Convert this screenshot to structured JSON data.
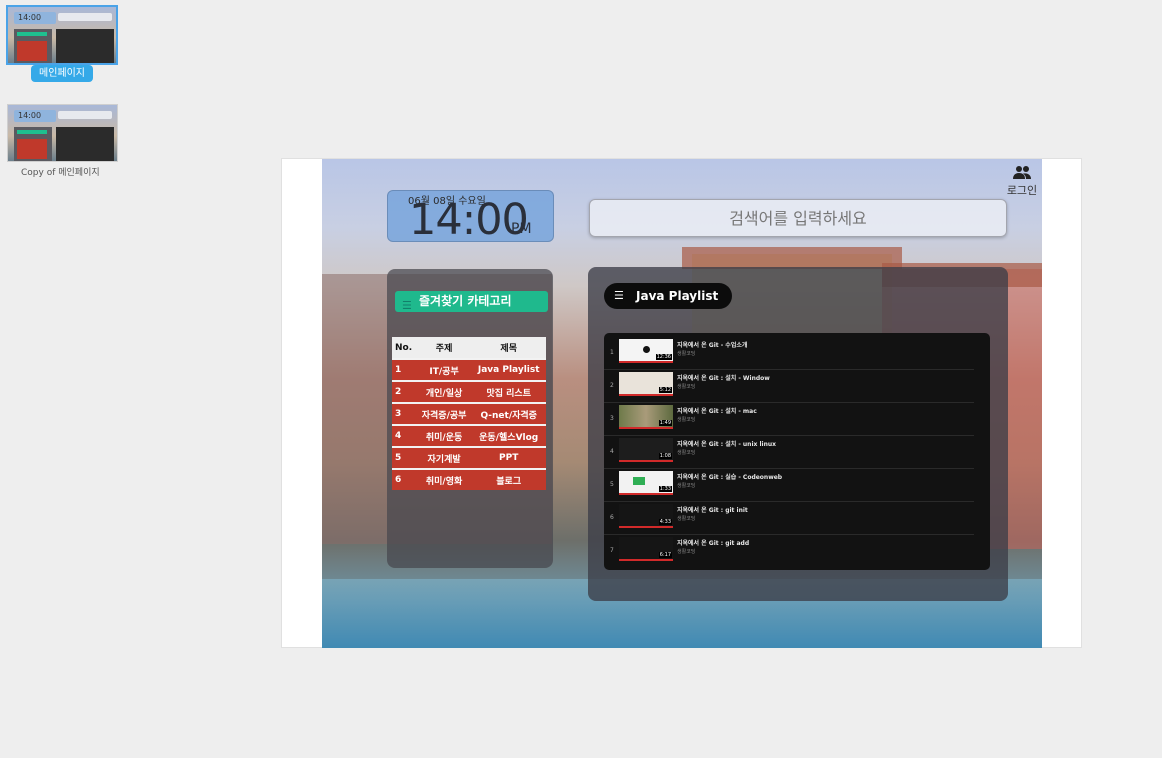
{
  "pages": [
    {
      "label": "메인페이지",
      "selected": true
    },
    {
      "label": "Copy of 메인페이지",
      "selected": false
    }
  ],
  "clock": {
    "date": "06월 08일 수요일",
    "time": "14:00",
    "ampm": "PM"
  },
  "search": {
    "placeholder": "검색어를 입력하세요"
  },
  "login": {
    "label": "로그인",
    "icon": "people-icon"
  },
  "bookmarks": {
    "title": "즐겨찾기 카테고리",
    "icon": "menu-icon",
    "columns": [
      "No.",
      "주제",
      "제목"
    ],
    "rows": [
      [
        "1",
        "IT/공부",
        "Java Playlist"
      ],
      [
        "2",
        "개인/일상",
        "맛집 리스트"
      ],
      [
        "3",
        "자격증/공부",
        "Q-net/자격증"
      ],
      [
        "4",
        "취미/운동",
        "운동/헬스Vlog"
      ],
      [
        "5",
        "자기계발",
        "PPT"
      ],
      [
        "6",
        "취미/영화",
        "블로그"
      ]
    ],
    "row_color": "#c0392b",
    "header_color": "#1fb98d"
  },
  "playlist": {
    "title": "Java Playlist",
    "icon": "menu-icon",
    "items": [
      {
        "num": "1",
        "title": "지옥에서 온 Git - 수업소개",
        "channel": "생활코딩",
        "duration": "12:36"
      },
      {
        "num": "2",
        "title": "지옥에서 온 Git : 설치 - Window",
        "channel": "생활코딩",
        "duration": "5:12"
      },
      {
        "num": "3",
        "title": "지옥에서 온 Git : 설치 - mac",
        "channel": "생활코딩",
        "duration": "1:49"
      },
      {
        "num": "4",
        "title": "지옥에서 온 Git : 설치 - unix linux",
        "channel": "생활코딩",
        "duration": "1:08"
      },
      {
        "num": "5",
        "title": "지옥에서 온 Git : 실습 - Codeonweb",
        "channel": "생활코딩",
        "duration": "1:33"
      },
      {
        "num": "6",
        "title": "지옥에서 온 Git : git init",
        "channel": "생활코딩",
        "duration": "4:33"
      },
      {
        "num": "7",
        "title": "지옥에서 온 Git : git add",
        "channel": "생활코딩",
        "duration": "6:17"
      }
    ]
  }
}
